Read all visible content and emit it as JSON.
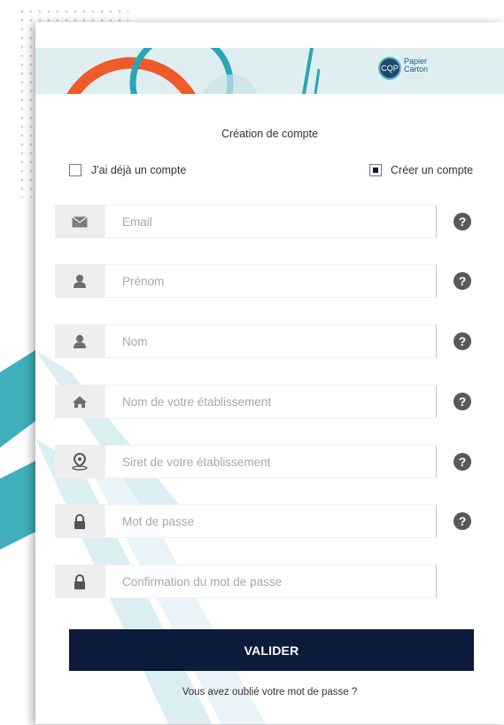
{
  "brand": {
    "logo_initials": "CQP",
    "logo_line1": "Papier",
    "logo_line2": "Carton"
  },
  "title": "Création de compte",
  "account_choice": {
    "existing_label": "J'ai déjà un compte",
    "existing_checked": false,
    "create_label": "Créer un compte",
    "create_checked": true
  },
  "fields": [
    {
      "placeholder": "Email",
      "icon": "envelope-icon",
      "help": "?"
    },
    {
      "placeholder": "Prénom",
      "icon": "user-icon",
      "help": "?"
    },
    {
      "placeholder": "Nom",
      "icon": "user-icon",
      "help": "?"
    },
    {
      "placeholder": "Nom de votre établissement",
      "icon": "home-icon",
      "help": "?"
    },
    {
      "placeholder": "Siret de votre établissement",
      "icon": "location-pin-icon",
      "help": "?"
    },
    {
      "placeholder": "Mot de passe",
      "icon": "lock-icon",
      "help": "?"
    },
    {
      "placeholder": "Confirmation du mot de passe",
      "icon": "lock-icon"
    }
  ],
  "submit_label": "VALIDER",
  "forgot_link": "Vous avez oublié votre mot de passe ?",
  "colors": {
    "accent_navy": "#0c1a3c",
    "teal": "#2aa6b4",
    "orange": "#ef5a2a",
    "banner": "#dfeff1"
  }
}
